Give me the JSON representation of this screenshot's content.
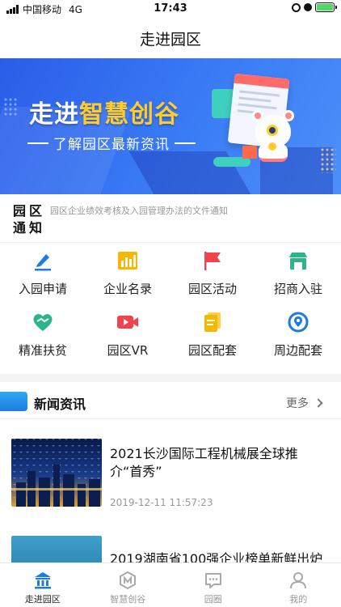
{
  "status_bar": {
    "carrier": "中国移动",
    "network": "4G",
    "time": "17:43"
  },
  "nav": {
    "title": "走进园区"
  },
  "banner": {
    "title_part1": "走进",
    "title_part2": "智慧创谷",
    "subtitle": "了解园区最新资讯",
    "page_count": 2,
    "active_page": 1
  },
  "notice": {
    "label_line1": "园区",
    "label_line2": "通知",
    "text": "园区企业绩效考核及入园管理办法的文件通知"
  },
  "features": [
    {
      "label": "入园申请",
      "icon": "pen-icon",
      "color": "#1e7be0"
    },
    {
      "label": "企业名录",
      "icon": "chart-icon",
      "color": "#f5b800"
    },
    {
      "label": "园区活动",
      "icon": "flag-icon",
      "color": "#f0434e"
    },
    {
      "label": "招商入驻",
      "icon": "store-icon",
      "color": "#2bb58a"
    },
    {
      "label": "精准扶贫",
      "icon": "handshake-icon",
      "color": "#2bb58a"
    },
    {
      "label": "园区VR",
      "icon": "video-icon",
      "color": "#f0434e"
    },
    {
      "label": "园区配套",
      "icon": "document-icon",
      "color": "#f5b800"
    },
    {
      "label": "周边配套",
      "icon": "location-icon",
      "color": "#1e7be0"
    }
  ],
  "news": {
    "title": "新闻资讯",
    "more": "更多",
    "items": [
      {
        "title": "2021长沙国际工程机械展全球推介“首秀”",
        "date": "2019-12-11 11:57:23"
      },
      {
        "title": "2019湖南省100强企业榜单新鲜出炉",
        "date": ""
      }
    ]
  },
  "tabs": [
    {
      "label": "走进园区",
      "icon": "building-icon",
      "active": true
    },
    {
      "label": "智慧创谷",
      "icon": "logo-icon",
      "active": false
    },
    {
      "label": "园圈",
      "icon": "chat-icon",
      "active": false
    },
    {
      "label": "我的",
      "icon": "user-icon",
      "active": false
    }
  ],
  "colors": {
    "accent": "#1e7be0",
    "banner": "#3a7cf5",
    "highlight": "#ffcc2a"
  }
}
